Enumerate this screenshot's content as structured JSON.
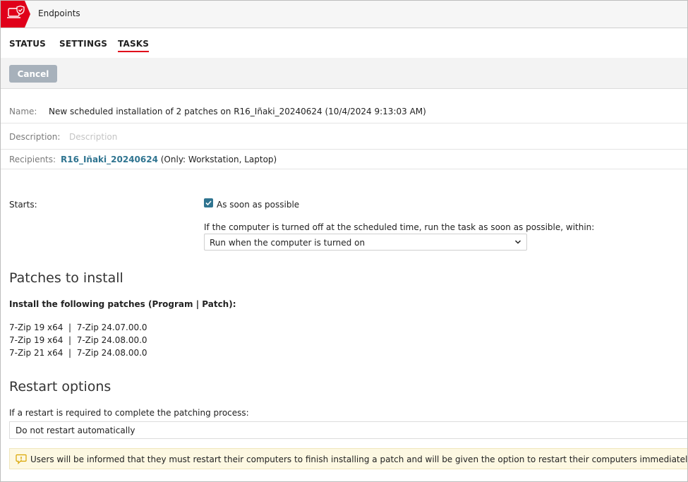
{
  "titlebar": {
    "title": "Endpoints",
    "logo_icon": "shield-check-icon",
    "brand_color": "#e0001a"
  },
  "tabs": [
    {
      "label": "STATUS",
      "active": false
    },
    {
      "label": "SETTINGS",
      "active": false
    },
    {
      "label": "TASKS",
      "active": true
    }
  ],
  "toolbar": {
    "cancel_label": "Cancel"
  },
  "details": {
    "name_label": "Name:",
    "name_value": "New scheduled installation of 2 patches on R16_Iñaki_20240624 (10/4/2024 9:13:03 AM)",
    "description_label": "Description:",
    "description_placeholder": "Description",
    "recipients_label": "Recipients:",
    "recipients_link": "R16_Iñaki_20240624",
    "recipients_suffix": " (Only: Workstation, Laptop)"
  },
  "starts": {
    "label": "Starts:",
    "asap_label": "As soon as possible",
    "asap_checked": true,
    "hint": "If the computer is turned off at the scheduled time, run the task as soon as possible, within:",
    "select_value": "Run when the computer is turned on"
  },
  "patches": {
    "title": "Patches to install",
    "subtitle": "Install the following patches (Program | Patch):",
    "items": [
      "7-Zip 19 x64  |  7-Zip 24.07.00.0",
      "7-Zip 19 x64  |  7-Zip 24.08.00.0",
      "7-Zip 21 x64  |  7-Zip 24.08.00.0"
    ]
  },
  "restart": {
    "title": "Restart options",
    "question": "If a restart is required to complete the patching process:",
    "select_value": "Do not restart automatically",
    "notice": "Users will be informed that they must restart their computers to finish installing a patch and will be given the option to restart their computers immediately or later"
  },
  "colors": {
    "accent": "#2f7490",
    "cancel_button": "#a7b1bb",
    "notice_bg": "#fdf8e2"
  }
}
